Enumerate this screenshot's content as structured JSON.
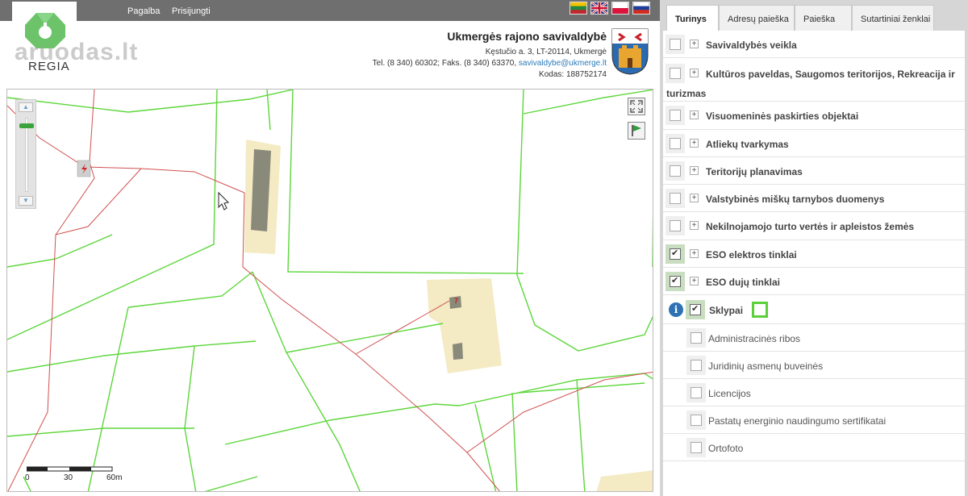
{
  "nav": {
    "help": "Pagalba",
    "login": "Prisijungti"
  },
  "flags": [
    "lithuanian-flag",
    "uk-flag",
    "polish-flag",
    "russian-flag"
  ],
  "logo": {
    "text": "REGIA",
    "watermark": "aruodas.lt"
  },
  "org": {
    "name": "Ukmergės rajono savivaldybė",
    "address": "Kęstučio a. 3, LT-20114, Ukmergė",
    "contacts_prefix": "Tel. (8 340) 60302; Faks. (8 340) 63370, ",
    "email": "savivaldybe@ukmerge.lt",
    "code": "Kodas: 188752174"
  },
  "map": {
    "scale_labels": [
      "0",
      "30",
      "60m"
    ],
    "parcel_number": "7",
    "colors": {
      "parcel_lines": "#5cd63a",
      "power_lines": "#d05050",
      "building": "#8a8a7a",
      "plot_fill": "#f0e6b8"
    }
  },
  "tabs": [
    "Turinys",
    "Adresų paieška",
    "Paieška",
    "Sutartiniai ženklai"
  ],
  "layers": [
    {
      "label": "Savivaldybės veikla",
      "checked": false
    },
    {
      "label": "Kultūros paveldas, Saugomos teritorijos, Rekreacija ir",
      "label2": "turizmas",
      "checked": false
    },
    {
      "label": "Visuomeninės paskirties objektai",
      "checked": false
    },
    {
      "label": "Atliekų tvarkymas",
      "checked": false
    },
    {
      "label": "Teritorijų planavimas",
      "checked": false
    },
    {
      "label": "Valstybinės miškų tarnybos duomenys",
      "checked": false
    },
    {
      "label": "Nekilnojamojo turto vertės ir apleistos žemės",
      "checked": false
    },
    {
      "label": "ESO elektros tinklai",
      "checked": true
    },
    {
      "label": "ESO dujų tinklai",
      "checked": true
    }
  ],
  "active_layer": {
    "label": "Sklypai",
    "checked": true,
    "legend_color": "#5bd03a"
  },
  "sublayers": [
    "Administracinės ribos",
    "Juridinių asmenų buveinės",
    "Licencijos",
    "Pastatų energinio naudingumo sertifikatai",
    "Ortofoto"
  ]
}
